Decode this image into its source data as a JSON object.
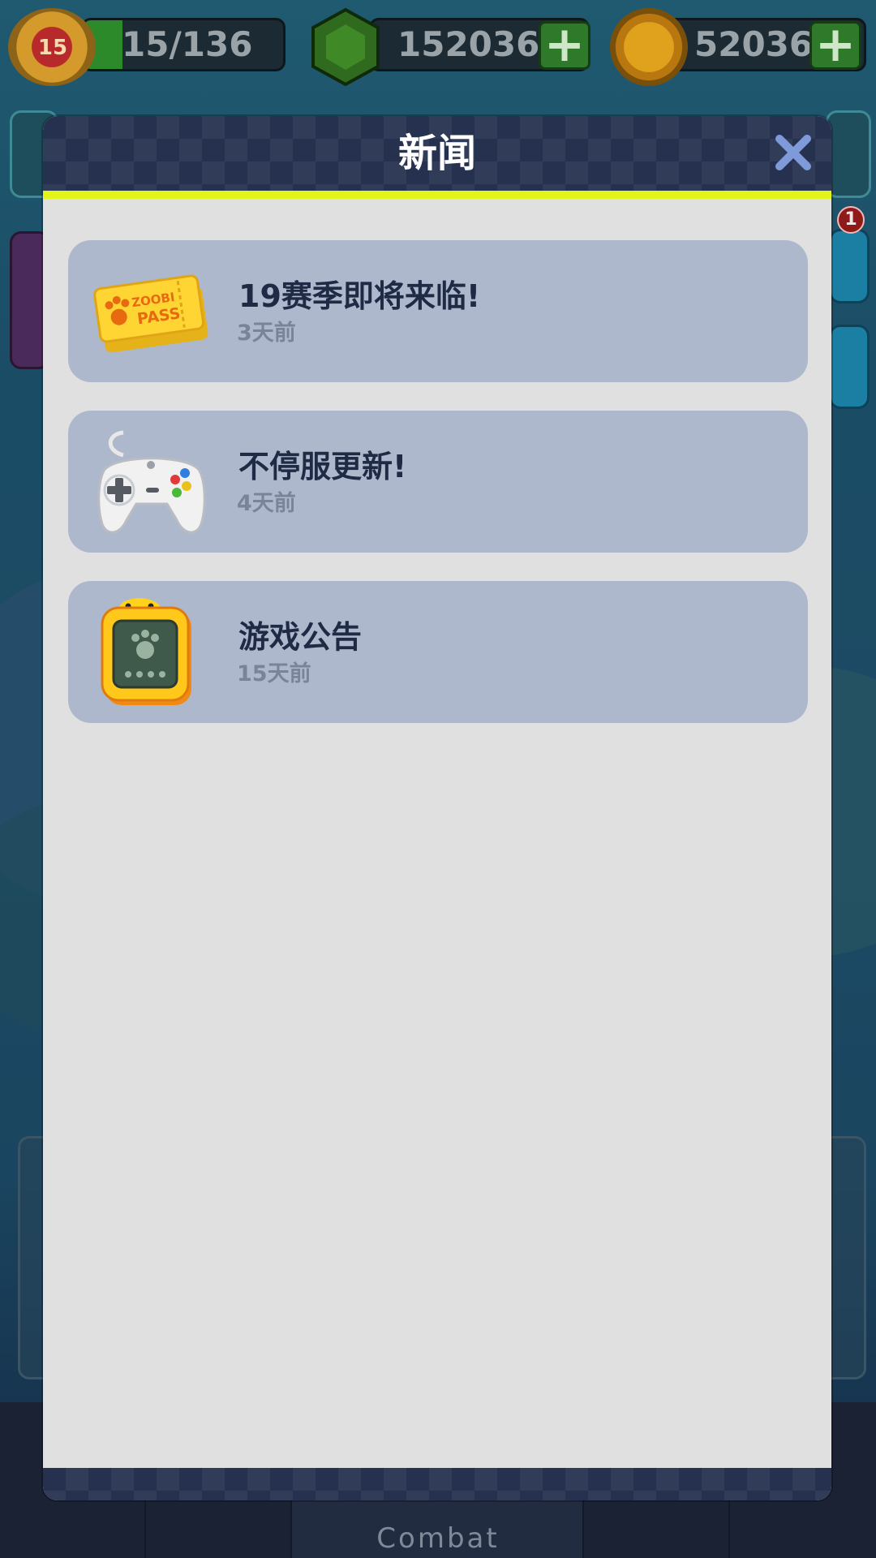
{
  "hud": {
    "level": "15",
    "energy": "15/136",
    "gems": "152036",
    "paw_coins": "52036"
  },
  "background": {
    "notification_count": "1",
    "bottom_nav_active_label": "Combat"
  },
  "modal": {
    "title": "新闻",
    "news_items": [
      {
        "title": "19赛季即将来临!",
        "time": "3天前",
        "icon": "zoobi-pass-ticket-icon",
        "ticket_text_1": "ZOOBI",
        "ticket_text_2": "PASS"
      },
      {
        "title": "不停服更新!",
        "time": "4天前",
        "icon": "gamepad-icon"
      },
      {
        "title": "游戏公告",
        "time": "15天前",
        "icon": "duck-tablet-icon"
      }
    ]
  },
  "colors": {
    "header_bg": "#26314f",
    "accent_stripe": "#e3f41b",
    "item_bg": "#aeb8cd",
    "modal_bg": "#e0e0e0",
    "close_icon": "#7f9ad8"
  }
}
